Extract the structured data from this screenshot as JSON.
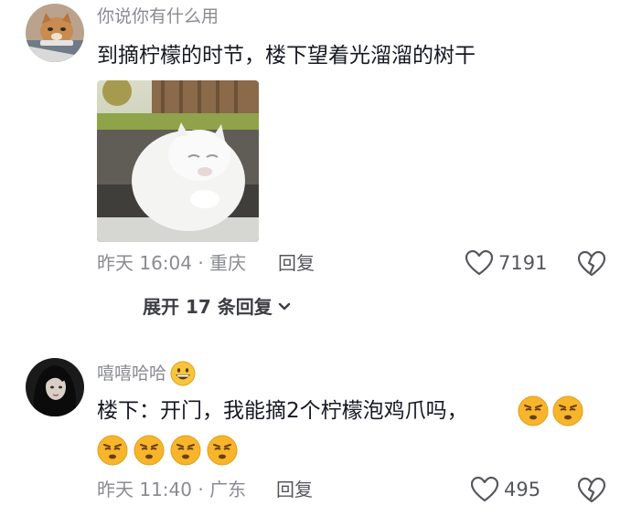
{
  "comment1": {
    "username": "你说你有什么用",
    "text": "到摘柠檬的时节，楼下望着光溜溜的树干",
    "meta": "昨天 16:04 · 重庆",
    "reply_label": "回复",
    "like_count": "7191",
    "expand_label": "展开 17 条回复",
    "photo_icon": "white-cat-photo"
  },
  "comment2": {
    "username": "嘻嘻哈哈",
    "username_emoji": "grinning-face-icon",
    "text": "楼下：开门，我能摘2个柠檬泡鸡爪吗，",
    "emoji_icon": "huffing-face-icon",
    "meta": "昨天 11:40 · 广东",
    "reply_label": "回复",
    "like_count": "495"
  },
  "colors": {
    "primary_text": "#161823",
    "secondary_text": "#8a8b91",
    "emoji_yellow": "#f7b52c"
  }
}
